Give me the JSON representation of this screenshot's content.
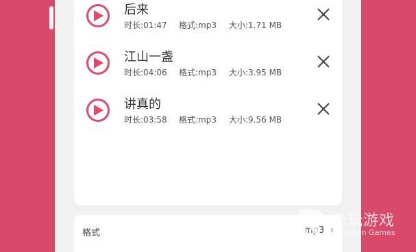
{
  "songs": [
    {
      "title": "后来",
      "duration": "时长:01:47",
      "format": "格式:mp3",
      "size": "大小:1.71 MB"
    },
    {
      "title": "江山一盏",
      "duration": "时长:04:06",
      "format": "格式:mp3",
      "size": "大小:3.95 MB"
    },
    {
      "title": "讲真的",
      "duration": "时长:03:58",
      "format": "格式:mp3",
      "size": "大小:9.56 MB"
    }
  ],
  "settings": {
    "format_label": "格式",
    "format_value": "mp3",
    "chevron": "›"
  },
  "watermark": {
    "cn": "仍玩游戏",
    "en": "Rengwan Games"
  },
  "colors": {
    "background": "#d94a6a",
    "accent": "#e24a6a",
    "panel": "#f1f1f1",
    "card": "#ffffff"
  },
  "icons": {
    "play": "play-circle-icon",
    "close": "close-icon",
    "chevron": "chevron-right-icon"
  }
}
